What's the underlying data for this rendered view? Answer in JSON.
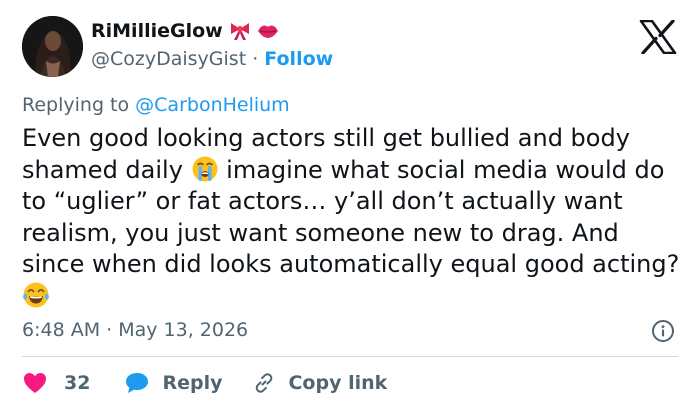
{
  "author": {
    "display_name": "RiMillieGlow",
    "handle": "@CozyDaisyGist",
    "follow_label": "Follow",
    "separator": "·"
  },
  "reply_context": {
    "prefix": "Replying to",
    "mention": "@CarbonHelium"
  },
  "tweet": {
    "text_1": "Even good looking actors still get bullied and body shamed daily ",
    "emoji_1": "loudly-crying-face",
    "text_2": " imagine what social media would do to “uglier” or fat actors… y’all don’t actually want realism, you just want someone new to drag. And since when did looks automatically equal good acting? ",
    "emoji_2": "face-with-tears-of-joy",
    "timestamp": "6:48 AM · May 13, 2026"
  },
  "actions": {
    "like_count": "32",
    "reply_label": "Reply",
    "copy_link_label": "Copy link"
  },
  "colors": {
    "accent": "#1d9bf0",
    "like": "#f91880",
    "muted": "#536471",
    "text": "#0f1419"
  },
  "icons": [
    "avatar-photo",
    "ribbon-emoji",
    "kiss-lips-emoji",
    "x-logo",
    "info-icon",
    "heart-icon",
    "reply-bubble-icon",
    "link-icon"
  ]
}
